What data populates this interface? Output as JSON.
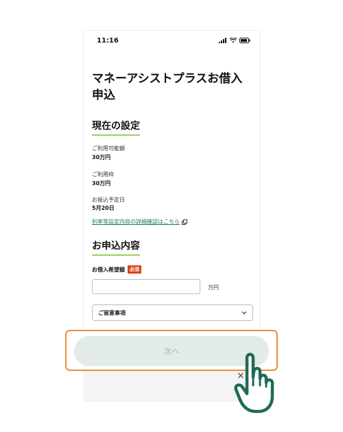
{
  "status_bar": {
    "time": "11:16"
  },
  "page": {
    "title": "マネーアシストプラスお借入申込"
  },
  "current_settings": {
    "heading": "現在の設定",
    "fields": [
      {
        "label": "ご利用可能額",
        "value": "30万円"
      },
      {
        "label": "ご利用枠",
        "value": "30万円"
      },
      {
        "label": "お振込予定日",
        "value": "5月20日"
      }
    ],
    "details_link": "利率等設定内容の詳細確認はこちら"
  },
  "application": {
    "heading": "お申込内容",
    "amount_label": "お借入希望額",
    "required_badge": "必須",
    "amount_value": "",
    "amount_unit": "万円",
    "notes_select": "ご留意事項"
  },
  "footer": {
    "next_label": "次へ",
    "close_label": "×"
  },
  "colors": {
    "accent_underline": "#9ccc65",
    "link": "#1a7f5a",
    "required_badge": "#d84315",
    "highlight": "#ef8c3a",
    "button_bg": "#e3ebe7",
    "hand_stroke": "#1f6b55"
  },
  "icons": [
    "signal-icon",
    "wifi-icon",
    "battery-icon",
    "external-link-icon",
    "chevron-down-icon",
    "close-icon",
    "pointing-hand-icon"
  ]
}
